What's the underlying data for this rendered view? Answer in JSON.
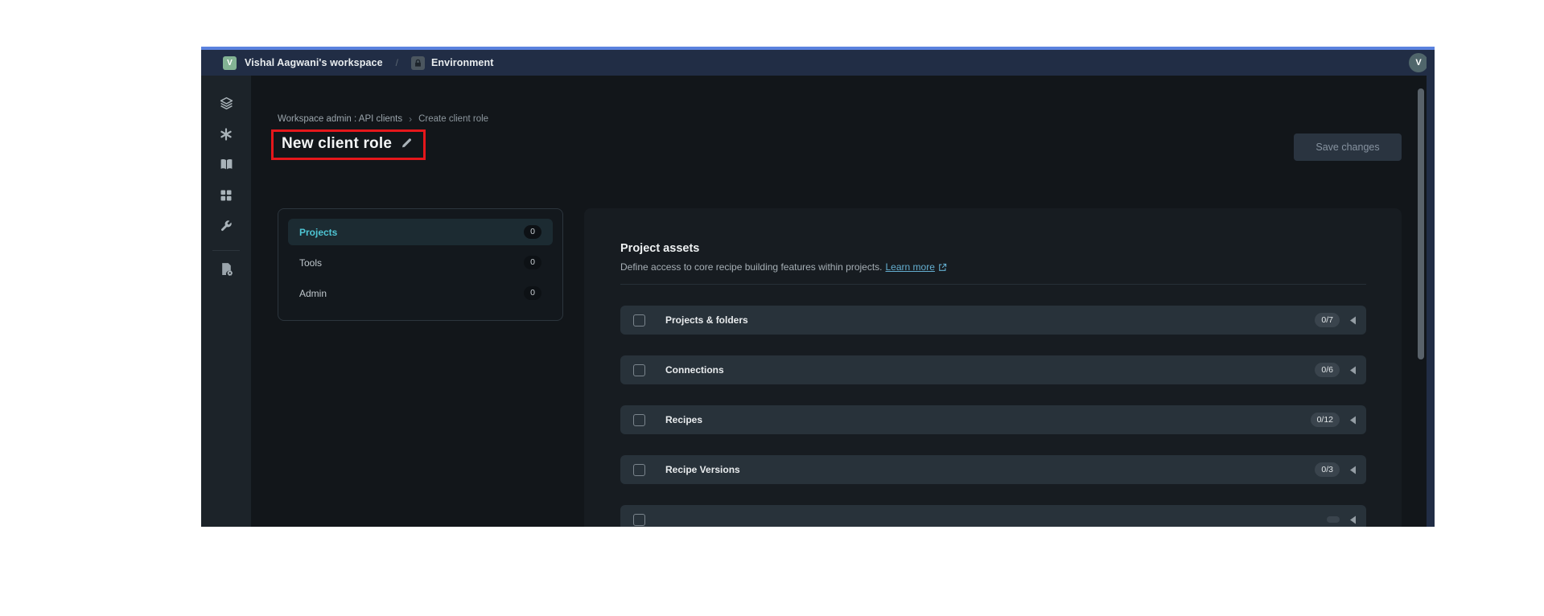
{
  "colors": {
    "accent_blue": "#5a82de",
    "topbar_navy": "#212d45",
    "selected_teal": "#4ec5d4",
    "annotation_red": "#e5171b",
    "workspace_green": "#83b394"
  },
  "topbar": {
    "workspace_initial": "V",
    "workspace_name": "Vishal Aagwani's workspace",
    "separator": "/",
    "environment_label": "Environment",
    "avatar_initial": "V"
  },
  "sidebar": {
    "icons": [
      "layers-stack-icon",
      "asterisk-icon",
      "library-book-icon",
      "dashboard-grid-icon",
      "tools-wrench-icon",
      "admin-file-gear-icon"
    ]
  },
  "page": {
    "breadcrumb": {
      "parent": "Workspace admin : API clients",
      "separator": "›",
      "current": "Create client role"
    },
    "title": "New client role",
    "save_button": "Save changes"
  },
  "tabs": {
    "items": [
      {
        "label": "Projects",
        "count": "0",
        "selected": true
      },
      {
        "label": "Tools",
        "count": "0",
        "selected": false
      },
      {
        "label": "Admin",
        "count": "0",
        "selected": false
      }
    ]
  },
  "panel": {
    "heading": "Project assets",
    "description": "Define access to core recipe building features within projects.",
    "link_label": "Learn more",
    "rows": [
      {
        "label": "Projects & folders",
        "count": "0/7"
      },
      {
        "label": "Connections",
        "count": "0/6"
      },
      {
        "label": "Recipes",
        "count": "0/12"
      },
      {
        "label": "Recipe Versions",
        "count": "0/3"
      },
      {
        "label": "",
        "count": ""
      }
    ]
  }
}
